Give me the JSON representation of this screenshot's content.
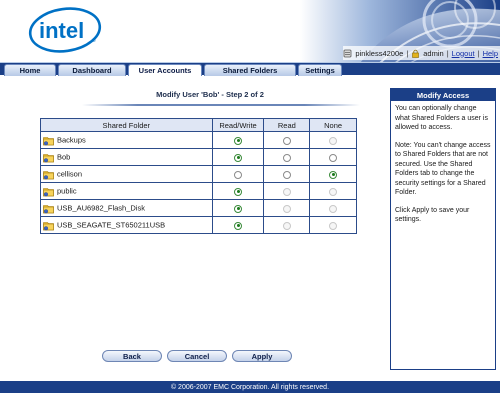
{
  "header": {
    "user_host": "pinkless4200e",
    "user_name": "admin",
    "logout_label": "Logout",
    "help_label": "Help",
    "separator": "|"
  },
  "tabs": [
    {
      "label": "Home",
      "active": false
    },
    {
      "label": "Dashboard",
      "active": false
    },
    {
      "label": "User Accounts",
      "active": true
    },
    {
      "label": "Shared Folders",
      "active": false
    },
    {
      "label": "Settings",
      "active": false
    }
  ],
  "main": {
    "title": "Modify User 'Bob' - Step 2 of 2",
    "columns": [
      "Shared Folder",
      "Read/Write",
      "Read",
      "None"
    ],
    "rows": [
      {
        "name": "Backups",
        "rw": "checked",
        "r": "unchecked",
        "none": "disabled"
      },
      {
        "name": "Bob",
        "rw": "checked",
        "r": "unchecked",
        "none": "unchecked"
      },
      {
        "name": "cellison",
        "rw": "unchecked",
        "r": "unchecked",
        "none": "checked"
      },
      {
        "name": "public",
        "rw": "checked",
        "r": "disabled",
        "none": "disabled"
      },
      {
        "name": "USB_AU6982_Flash_Disk",
        "rw": "checked",
        "r": "disabled",
        "none": "disabled"
      },
      {
        "name": "USB_SEAGATE_ST650211USB",
        "rw": "checked",
        "r": "disabled",
        "none": "disabled"
      }
    ]
  },
  "buttons": {
    "back_label": "Back",
    "cancel_label": "Cancel",
    "apply_label": "Apply"
  },
  "help": {
    "title": "Modify Access",
    "para1": "You can optionally change what Shared Folders a user is allowed to access.",
    "para2": "Note: You can't change access to Shared Folders that are not secured. Use the Shared Folders tab to change the security settings for a Shared Folder.",
    "para3": "Click Apply to save your settings."
  },
  "footer": {
    "text": "© 2006-2007 EMC Corporation. All rights reserved."
  },
  "colors": {
    "nav_blue": "#1b3f87",
    "header_blue": "#dfe6f4",
    "brand_blue": "#0071c5"
  },
  "icons": {
    "server": "server-icon",
    "lock": "lock-icon",
    "folder": "folder-icon",
    "secure_folder": "locked-folder-icon"
  }
}
